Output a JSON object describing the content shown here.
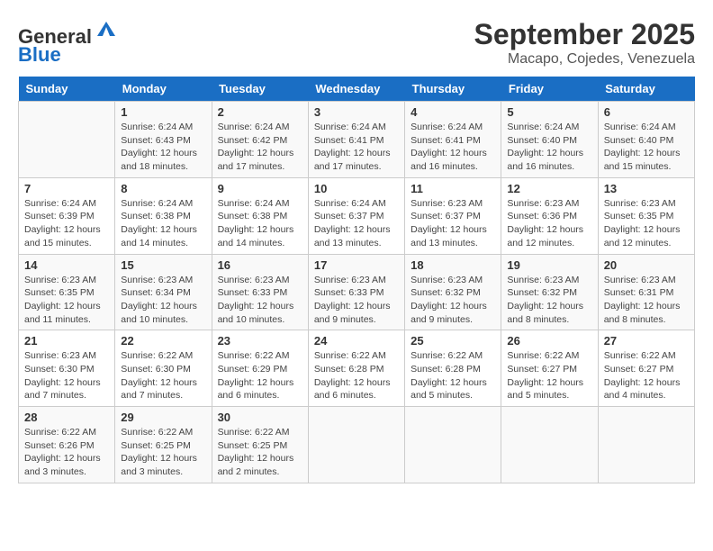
{
  "header": {
    "logo_line1": "General",
    "logo_line2": "Blue",
    "month": "September 2025",
    "location": "Macapo, Cojedes, Venezuela"
  },
  "weekdays": [
    "Sunday",
    "Monday",
    "Tuesday",
    "Wednesday",
    "Thursday",
    "Friday",
    "Saturday"
  ],
  "weeks": [
    [
      {
        "day": "",
        "info": ""
      },
      {
        "day": "1",
        "info": "Sunrise: 6:24 AM\nSunset: 6:43 PM\nDaylight: 12 hours\nand 18 minutes."
      },
      {
        "day": "2",
        "info": "Sunrise: 6:24 AM\nSunset: 6:42 PM\nDaylight: 12 hours\nand 17 minutes."
      },
      {
        "day": "3",
        "info": "Sunrise: 6:24 AM\nSunset: 6:41 PM\nDaylight: 12 hours\nand 17 minutes."
      },
      {
        "day": "4",
        "info": "Sunrise: 6:24 AM\nSunset: 6:41 PM\nDaylight: 12 hours\nand 16 minutes."
      },
      {
        "day": "5",
        "info": "Sunrise: 6:24 AM\nSunset: 6:40 PM\nDaylight: 12 hours\nand 16 minutes."
      },
      {
        "day": "6",
        "info": "Sunrise: 6:24 AM\nSunset: 6:40 PM\nDaylight: 12 hours\nand 15 minutes."
      }
    ],
    [
      {
        "day": "7",
        "info": "Sunrise: 6:24 AM\nSunset: 6:39 PM\nDaylight: 12 hours\nand 15 minutes."
      },
      {
        "day": "8",
        "info": "Sunrise: 6:24 AM\nSunset: 6:38 PM\nDaylight: 12 hours\nand 14 minutes."
      },
      {
        "day": "9",
        "info": "Sunrise: 6:24 AM\nSunset: 6:38 PM\nDaylight: 12 hours\nand 14 minutes."
      },
      {
        "day": "10",
        "info": "Sunrise: 6:24 AM\nSunset: 6:37 PM\nDaylight: 12 hours\nand 13 minutes."
      },
      {
        "day": "11",
        "info": "Sunrise: 6:23 AM\nSunset: 6:37 PM\nDaylight: 12 hours\nand 13 minutes."
      },
      {
        "day": "12",
        "info": "Sunrise: 6:23 AM\nSunset: 6:36 PM\nDaylight: 12 hours\nand 12 minutes."
      },
      {
        "day": "13",
        "info": "Sunrise: 6:23 AM\nSunset: 6:35 PM\nDaylight: 12 hours\nand 12 minutes."
      }
    ],
    [
      {
        "day": "14",
        "info": "Sunrise: 6:23 AM\nSunset: 6:35 PM\nDaylight: 12 hours\nand 11 minutes."
      },
      {
        "day": "15",
        "info": "Sunrise: 6:23 AM\nSunset: 6:34 PM\nDaylight: 12 hours\nand 10 minutes."
      },
      {
        "day": "16",
        "info": "Sunrise: 6:23 AM\nSunset: 6:33 PM\nDaylight: 12 hours\nand 10 minutes."
      },
      {
        "day": "17",
        "info": "Sunrise: 6:23 AM\nSunset: 6:33 PM\nDaylight: 12 hours\nand 9 minutes."
      },
      {
        "day": "18",
        "info": "Sunrise: 6:23 AM\nSunset: 6:32 PM\nDaylight: 12 hours\nand 9 minutes."
      },
      {
        "day": "19",
        "info": "Sunrise: 6:23 AM\nSunset: 6:32 PM\nDaylight: 12 hours\nand 8 minutes."
      },
      {
        "day": "20",
        "info": "Sunrise: 6:23 AM\nSunset: 6:31 PM\nDaylight: 12 hours\nand 8 minutes."
      }
    ],
    [
      {
        "day": "21",
        "info": "Sunrise: 6:23 AM\nSunset: 6:30 PM\nDaylight: 12 hours\nand 7 minutes."
      },
      {
        "day": "22",
        "info": "Sunrise: 6:22 AM\nSunset: 6:30 PM\nDaylight: 12 hours\nand 7 minutes."
      },
      {
        "day": "23",
        "info": "Sunrise: 6:22 AM\nSunset: 6:29 PM\nDaylight: 12 hours\nand 6 minutes."
      },
      {
        "day": "24",
        "info": "Sunrise: 6:22 AM\nSunset: 6:28 PM\nDaylight: 12 hours\nand 6 minutes."
      },
      {
        "day": "25",
        "info": "Sunrise: 6:22 AM\nSunset: 6:28 PM\nDaylight: 12 hours\nand 5 minutes."
      },
      {
        "day": "26",
        "info": "Sunrise: 6:22 AM\nSunset: 6:27 PM\nDaylight: 12 hours\nand 5 minutes."
      },
      {
        "day": "27",
        "info": "Sunrise: 6:22 AM\nSunset: 6:27 PM\nDaylight: 12 hours\nand 4 minutes."
      }
    ],
    [
      {
        "day": "28",
        "info": "Sunrise: 6:22 AM\nSunset: 6:26 PM\nDaylight: 12 hours\nand 3 minutes."
      },
      {
        "day": "29",
        "info": "Sunrise: 6:22 AM\nSunset: 6:25 PM\nDaylight: 12 hours\nand 3 minutes."
      },
      {
        "day": "30",
        "info": "Sunrise: 6:22 AM\nSunset: 6:25 PM\nDaylight: 12 hours\nand 2 minutes."
      },
      {
        "day": "",
        "info": ""
      },
      {
        "day": "",
        "info": ""
      },
      {
        "day": "",
        "info": ""
      },
      {
        "day": "",
        "info": ""
      }
    ]
  ]
}
